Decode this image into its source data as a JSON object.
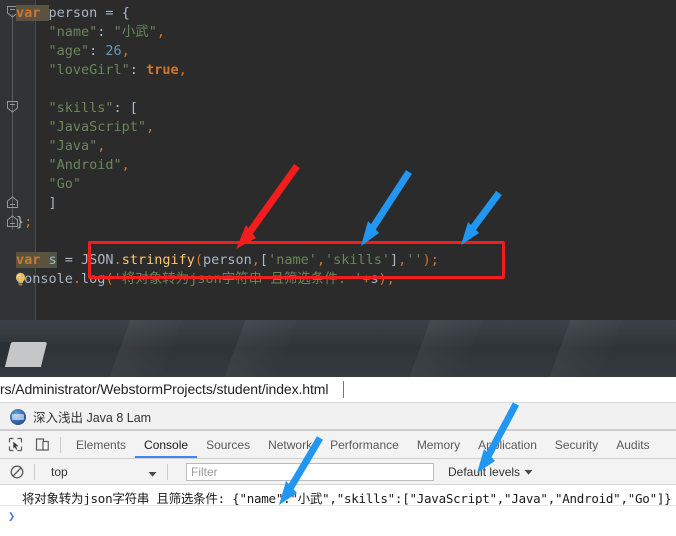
{
  "editor": {
    "lines": [
      [
        {
          "t": "var ",
          "c": "kw-hl-var"
        },
        {
          "t": "person = {",
          "c": "plain"
        }
      ],
      [
        {
          "t": "    ",
          "c": "plain"
        },
        {
          "t": "\"name\"",
          "c": "str"
        },
        {
          "t": ": ",
          "c": "plain"
        },
        {
          "t": "\"小武\"",
          "c": "str"
        },
        {
          "t": ",",
          "c": "orange"
        }
      ],
      [
        {
          "t": "    ",
          "c": "plain"
        },
        {
          "t": "\"age\"",
          "c": "str"
        },
        {
          "t": ": ",
          "c": "plain"
        },
        {
          "t": "26",
          "c": "num"
        },
        {
          "t": ",",
          "c": "orange"
        }
      ],
      [
        {
          "t": "    ",
          "c": "plain"
        },
        {
          "t": "\"loveGirl\"",
          "c": "str"
        },
        {
          "t": ": ",
          "c": "plain"
        },
        {
          "t": "true",
          "c": "kw"
        },
        {
          "t": ",",
          "c": "orange"
        }
      ],
      [],
      [
        {
          "t": "    ",
          "c": "plain"
        },
        {
          "t": "\"skills\"",
          "c": "str"
        },
        {
          "t": ": [",
          "c": "plain"
        }
      ],
      [
        {
          "t": "    ",
          "c": "plain"
        },
        {
          "t": "\"JavaScript\"",
          "c": "str"
        },
        {
          "t": ",",
          "c": "orange"
        }
      ],
      [
        {
          "t": "    ",
          "c": "plain"
        },
        {
          "t": "\"Java\"",
          "c": "str"
        },
        {
          "t": ",",
          "c": "orange"
        }
      ],
      [
        {
          "t": "    ",
          "c": "plain"
        },
        {
          "t": "\"Android\"",
          "c": "str"
        },
        {
          "t": ",",
          "c": "orange"
        }
      ],
      [
        {
          "t": "    ",
          "c": "plain"
        },
        {
          "t": "\"Go\"",
          "c": "str"
        }
      ],
      [
        {
          "t": "    ]",
          "c": "plain"
        }
      ],
      [
        {
          "t": "}",
          "c": "plain"
        },
        {
          "t": ";",
          "c": "orange"
        }
      ],
      [],
      [
        {
          "t": "var ",
          "c": "kw-hl-var"
        },
        {
          "t": "s",
          "c": "id-hl"
        },
        {
          "t": " = ",
          "c": "plain"
        },
        {
          "t": "JSON",
          "c": "plain"
        },
        {
          "t": ".",
          "c": "orange"
        },
        {
          "t": "stringify",
          "c": "fn"
        },
        {
          "t": "(",
          "c": "orange"
        },
        {
          "t": "person",
          "c": "plain"
        },
        {
          "t": ",",
          "c": "orange"
        },
        {
          "t": "[",
          "c": "plain"
        },
        {
          "t": "'name'",
          "c": "str"
        },
        {
          "t": ",",
          "c": "orange"
        },
        {
          "t": "'skills'",
          "c": "str"
        },
        {
          "t": "]",
          "c": "plain"
        },
        {
          "t": ",",
          "c": "orange"
        },
        {
          "t": "''",
          "c": "str"
        },
        {
          "t": ")",
          "c": "orange"
        },
        {
          "t": ";",
          "c": "orange"
        }
      ],
      [
        {
          "t": "console",
          "c": "plain"
        },
        {
          "t": ".",
          "c": "orange"
        },
        {
          "t": "log",
          "c": "plain"
        },
        {
          "t": "(",
          "c": "orange"
        },
        {
          "t": "'将对象转为json字符串 且筛选条件: '",
          "c": "str"
        },
        {
          "t": "+",
          "c": "orange"
        },
        {
          "t": "s",
          "c": "plain"
        },
        {
          "t": ")",
          "c": "orange"
        },
        {
          "t": ";",
          "c": "orange"
        }
      ]
    ],
    "highlight_box_color": "#f31d1d"
  },
  "browser": {
    "url": "rs/Administrator/WebstormProjects/student/index.html",
    "bookmark": {
      "label": "深入浅出 Java 8 Lam",
      "icon": "java-duke-icon"
    }
  },
  "devtools": {
    "tabs": [
      {
        "label": "Elements",
        "active": false
      },
      {
        "label": "Console",
        "active": true
      },
      {
        "label": "Sources",
        "active": false
      },
      {
        "label": "Network",
        "active": false
      },
      {
        "label": "Performance",
        "active": false
      },
      {
        "label": "Memory",
        "active": false
      },
      {
        "label": "Application",
        "active": false
      },
      {
        "label": "Security",
        "active": false
      },
      {
        "label": "Audits",
        "active": false
      }
    ],
    "active_tab_underline": "#4285f4",
    "filterbar": {
      "clear_icon": "no-entry-icon",
      "context": "top",
      "filter_placeholder": "Filter",
      "filter_value": "",
      "levels_label": "Default levels"
    },
    "console": {
      "message": "将对象转为json字符串 且筛选条件: {\"name\":\"小武\",\"skills\":[\"JavaScript\",\"Java\",\"Android\",\"Go\"]}",
      "prompt": "❯"
    }
  },
  "annotations": {
    "red_arrow_color": "#f31d1d",
    "blue_arrow_color": "#2196f3",
    "arrows": [
      {
        "name": "red-arrow-person",
        "color": "#f31d1d"
      },
      {
        "name": "blue-arrow-filter-array",
        "color": "#2196f3"
      },
      {
        "name": "blue-arrow-indent",
        "color": "#2196f3"
      },
      {
        "name": "blue-arrow-console-output-left",
        "color": "#2196f3"
      },
      {
        "name": "blue-arrow-console-output-right",
        "color": "#2196f3"
      }
    ]
  }
}
